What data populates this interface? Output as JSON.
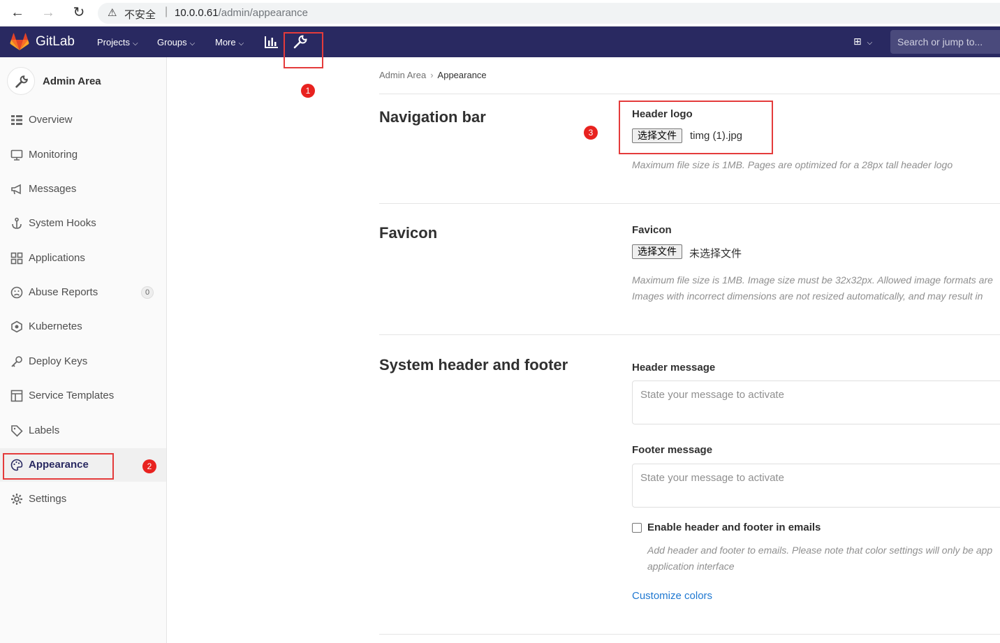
{
  "browser": {
    "insecure_label": "不安全",
    "url_host": "10.0.0.61",
    "url_path": "/admin/appearance"
  },
  "topnav": {
    "brand": "GitLab",
    "menus": [
      "Projects",
      "Groups",
      "More"
    ],
    "search_placeholder": "Search or jump to..."
  },
  "sidebar": {
    "title": "Admin Area",
    "items": [
      {
        "label": "Overview",
        "icon": "overview-icon"
      },
      {
        "label": "Monitoring",
        "icon": "monitor-icon"
      },
      {
        "label": "Messages",
        "icon": "megaphone-icon"
      },
      {
        "label": "System Hooks",
        "icon": "hook-icon"
      },
      {
        "label": "Applications",
        "icon": "grid-icon"
      },
      {
        "label": "Abuse Reports",
        "icon": "face-icon",
        "badge": "0"
      },
      {
        "label": "Kubernetes",
        "icon": "cloud-icon"
      },
      {
        "label": "Deploy Keys",
        "icon": "key-icon"
      },
      {
        "label": "Service Templates",
        "icon": "template-icon"
      },
      {
        "label": "Labels",
        "icon": "label-icon"
      },
      {
        "label": "Appearance",
        "icon": "palette-icon",
        "active": true
      },
      {
        "label": "Settings",
        "icon": "gear-icon"
      }
    ]
  },
  "breadcrumb": {
    "parent": "Admin Area",
    "current": "Appearance"
  },
  "navigation_bar": {
    "title": "Navigation bar",
    "field_label": "Header logo",
    "file_button": "选择文件",
    "file_name": "timg (1).jpg",
    "help": "Maximum file size is 1MB. Pages are optimized for a 28px tall header logo"
  },
  "favicon": {
    "title": "Favicon",
    "field_label": "Favicon",
    "file_button": "选择文件",
    "file_name": "未选择文件",
    "help_line1": "Maximum file size is 1MB. Image size must be 32x32px. Allowed image formats are",
    "help_line2": "Images with incorrect dimensions are not resized automatically, and may result in"
  },
  "system_header_footer": {
    "title": "System header and footer",
    "header_label": "Header message",
    "header_placeholder": "State your message to activate",
    "footer_label": "Footer message",
    "footer_placeholder": "State your message to activate",
    "checkbox_label": "Enable header and footer in emails",
    "checkbox_help_line1": "Add header and footer to emails. Please note that color settings will only be app",
    "checkbox_help_line2": "application interface",
    "customize_link": "Customize colors"
  },
  "annotations": [
    "1",
    "2",
    "3"
  ],
  "colors": {
    "nav_bg": "#292961",
    "highlight": "#e43b3b",
    "link": "#1f78d1"
  }
}
